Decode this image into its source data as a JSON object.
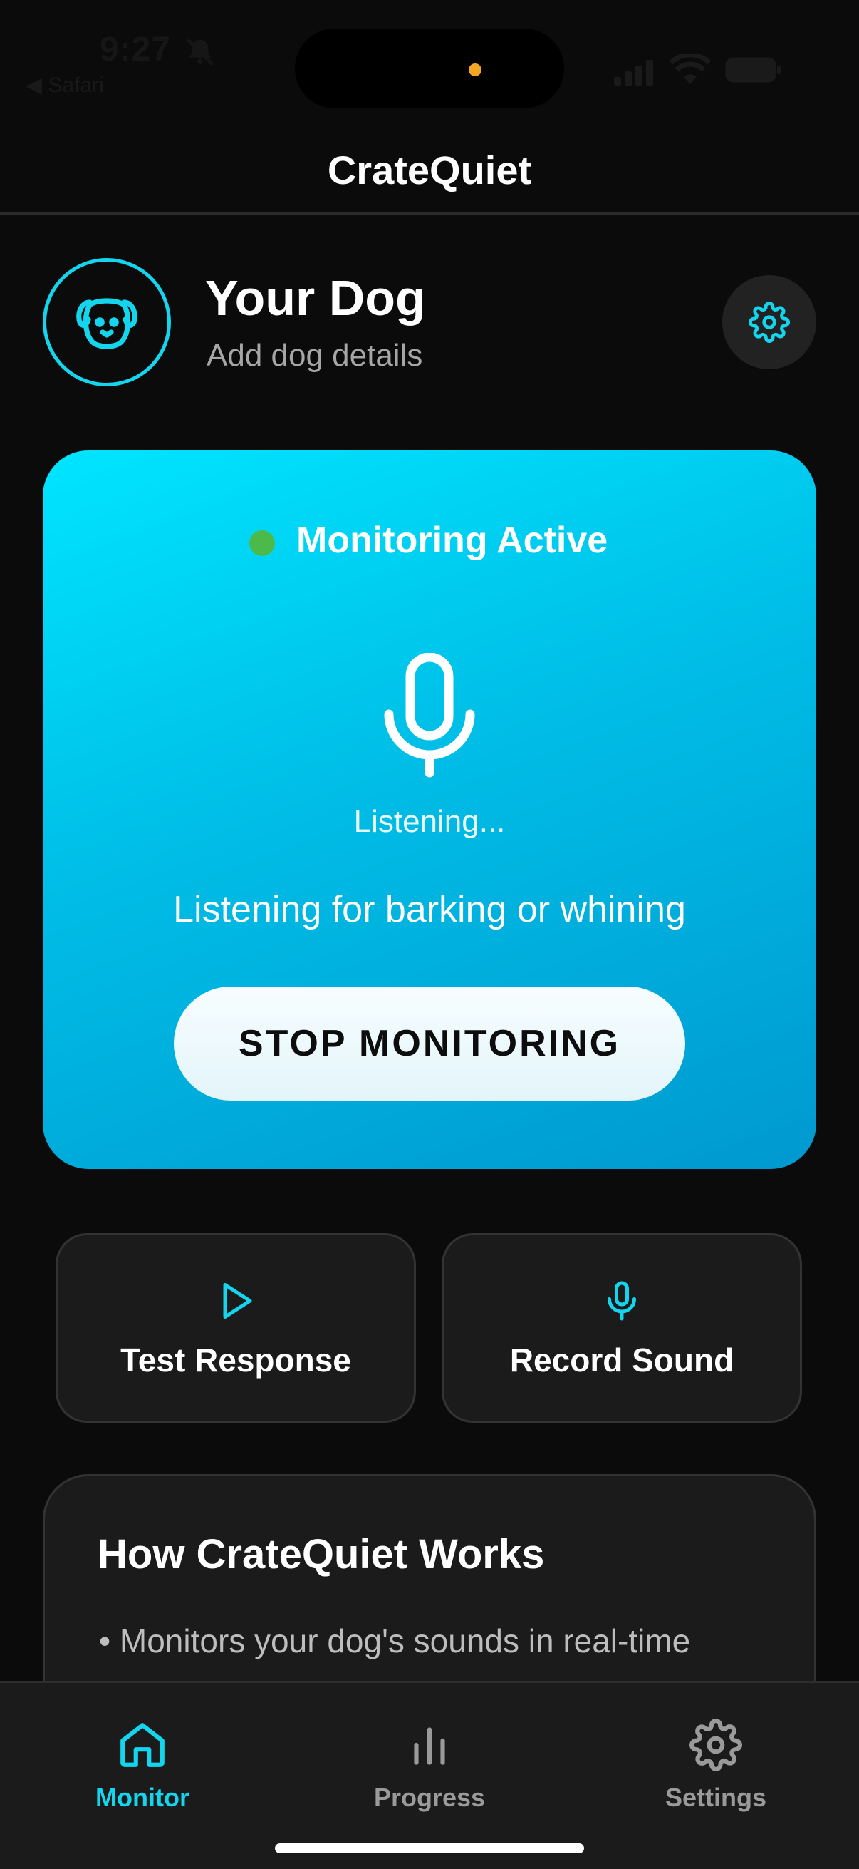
{
  "status_bar": {
    "time": "9:27",
    "back_app": "◀ Safari"
  },
  "header": {
    "title": "CrateQuiet"
  },
  "profile": {
    "name": "Your Dog",
    "subtitle": "Add dog details"
  },
  "monitor": {
    "status": "Monitoring Active",
    "listening_label": "Listening...",
    "description": "Listening for barking or whining",
    "stop_button": "STOP MONITORING"
  },
  "actions": {
    "test_label": "Test Response",
    "record_label": "Record Sound"
  },
  "how_it_works": {
    "title": "How CrateQuiet Works",
    "items": [
      "• Monitors your dog's sounds in real-time"
    ]
  },
  "tabs": [
    {
      "label": "Monitor",
      "icon": "home-icon",
      "active": true
    },
    {
      "label": "Progress",
      "icon": "bar-chart-icon",
      "active": false
    },
    {
      "label": "Settings",
      "icon": "gear-icon",
      "active": false
    }
  ],
  "colors": {
    "accent": "#13d6ee",
    "card_gradient_start": "#00e5ff",
    "card_gradient_end": "#0099cf",
    "active_dot": "#4cba4a",
    "background": "#0b0b0b",
    "surface": "#1b1b1b"
  }
}
